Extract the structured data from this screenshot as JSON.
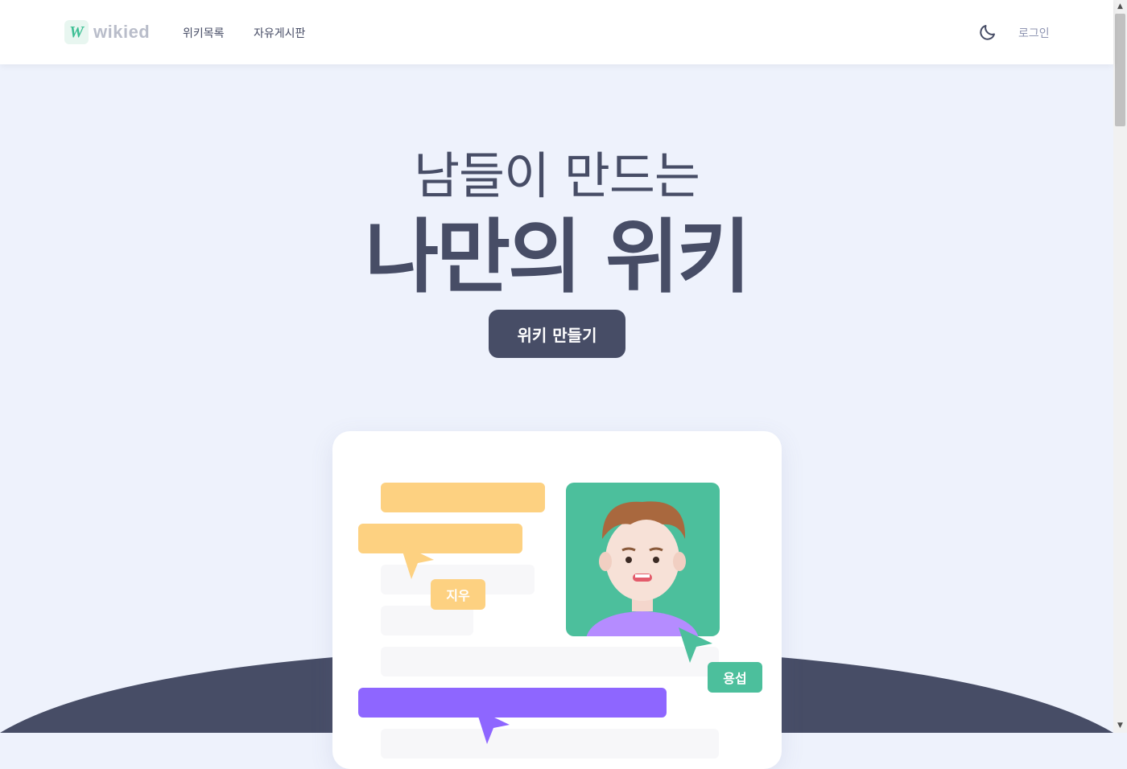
{
  "header": {
    "logo_text": "wikied",
    "logo_mark": "W",
    "nav": [
      "위키목록",
      "자유게시판"
    ],
    "theme_icon": "moon-icon",
    "login_label": "로그인"
  },
  "hero": {
    "subtitle": "남들이 만드는",
    "title": "나만의 위키",
    "cta_label": "위키 만들기"
  },
  "illustration": {
    "tags": [
      "지우",
      "용섭"
    ]
  },
  "colors": {
    "primary": "#474d66",
    "accent_green": "#4cbf9c",
    "accent_yellow": "#fdd181",
    "accent_purple": "#8e66ff",
    "background": "#eef2fc"
  }
}
